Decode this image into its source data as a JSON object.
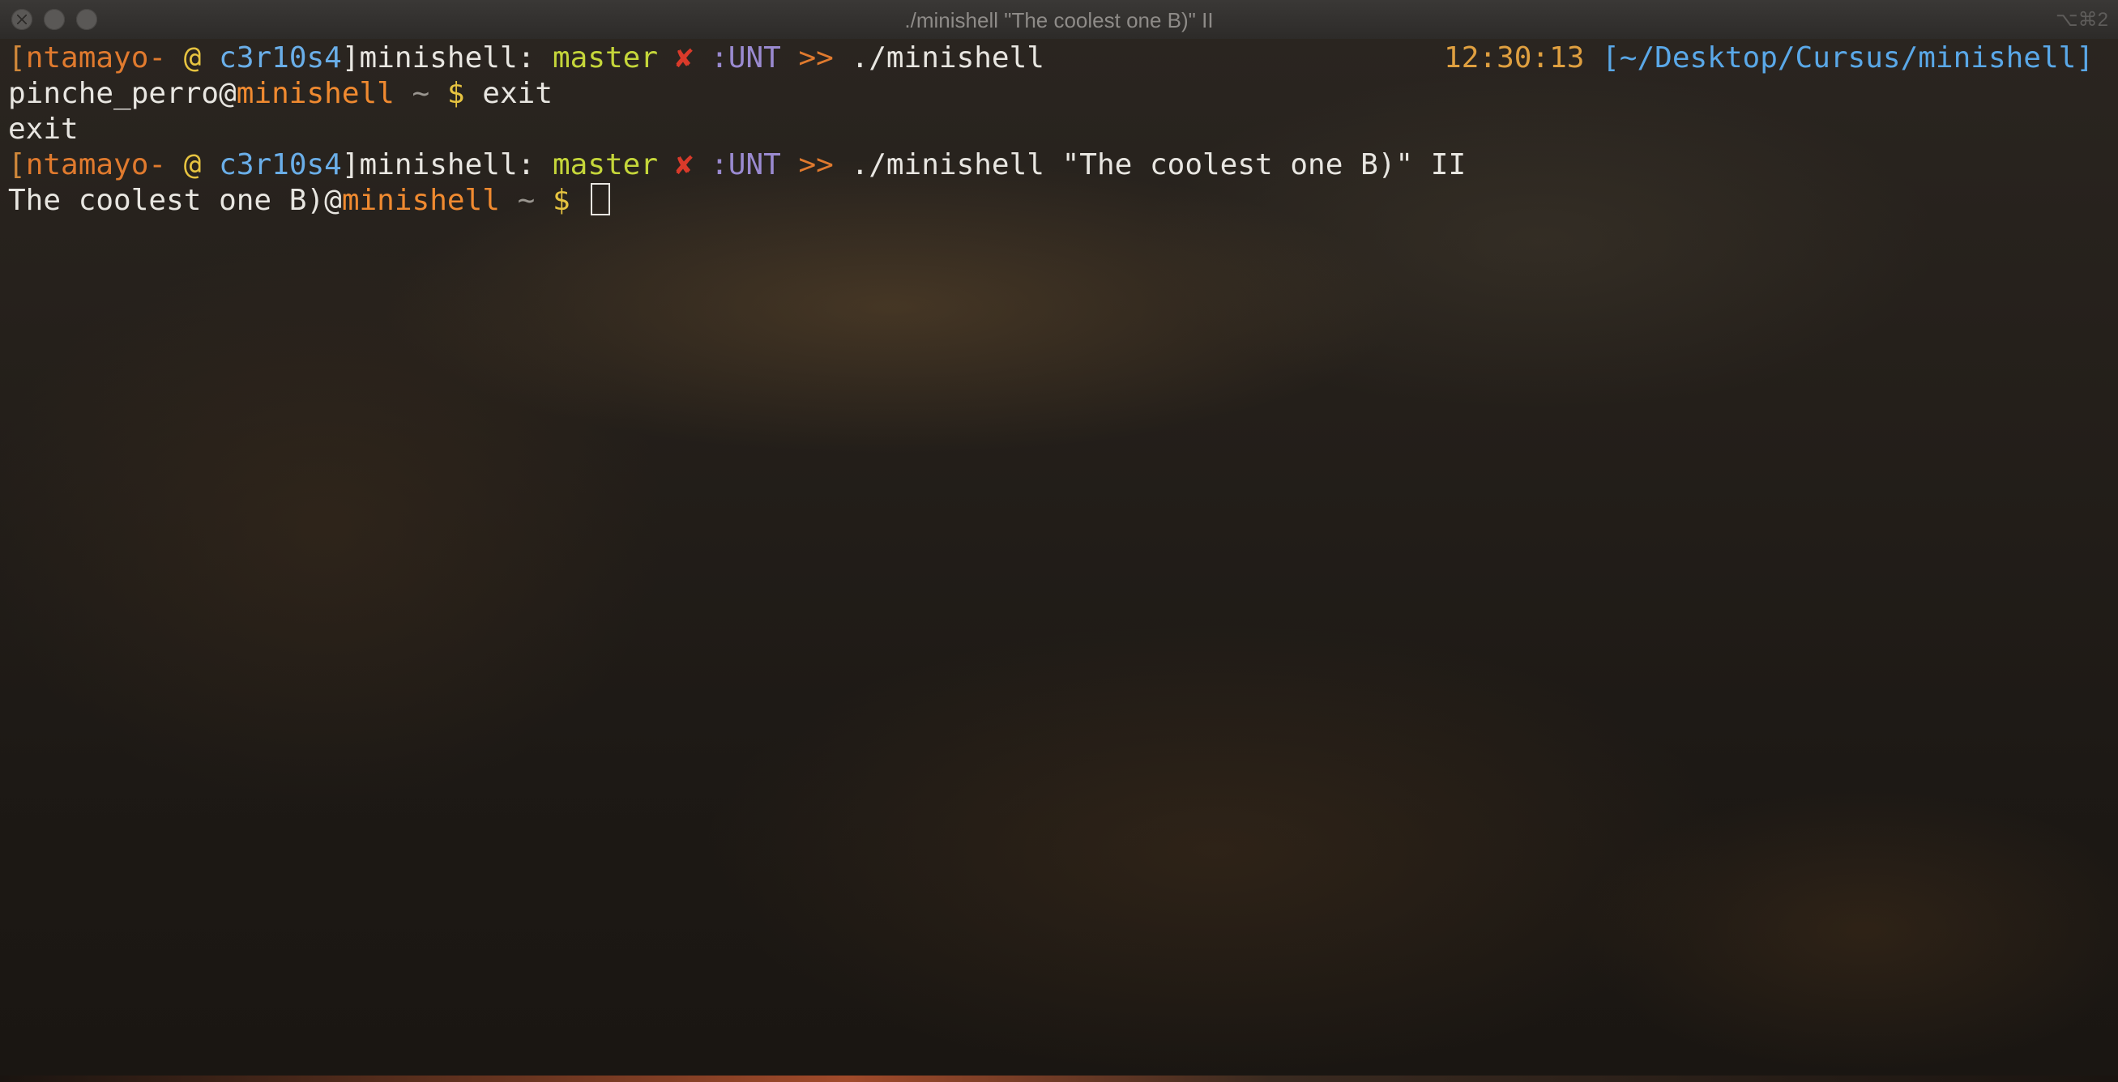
{
  "window": {
    "title": "./minishell \"The coolest one B)\" II",
    "shortcut": "⌥⌘2"
  },
  "prompt": {
    "open_bracket": "[",
    "user": "ntamayo-",
    "at": "@",
    "host": "c3r10s4",
    "close_bracket": "]",
    "dir": "minishell:",
    "branch": "master",
    "dirty_mark": "✘",
    "status": ":UNT",
    "arrows": ">>"
  },
  "lines": [
    {
      "command": "./minishell"
    },
    {
      "user": "pinche_perro",
      "at": "@",
      "host": "minishell",
      "tilde": "~",
      "dollar": "$",
      "command": "exit"
    },
    {
      "output": "exit"
    },
    {
      "command": "./minishell \"The coolest one B)\" II"
    },
    {
      "user": "The coolest one B)",
      "at": "@",
      "host": "minishell",
      "tilde": "~",
      "dollar": "$"
    }
  ],
  "right_info": {
    "time": "12:30:13",
    "path": "[~/Desktop/Cursus/minishell]"
  },
  "colors": {
    "user": "#e07a2e",
    "host": "#6aaee8",
    "branch": "#c5d63a",
    "dirty": "#d93a2a",
    "status": "#9a8ad0",
    "time": "#e0a040",
    "path": "#5aa8e8",
    "text": "#e8e6e1"
  }
}
